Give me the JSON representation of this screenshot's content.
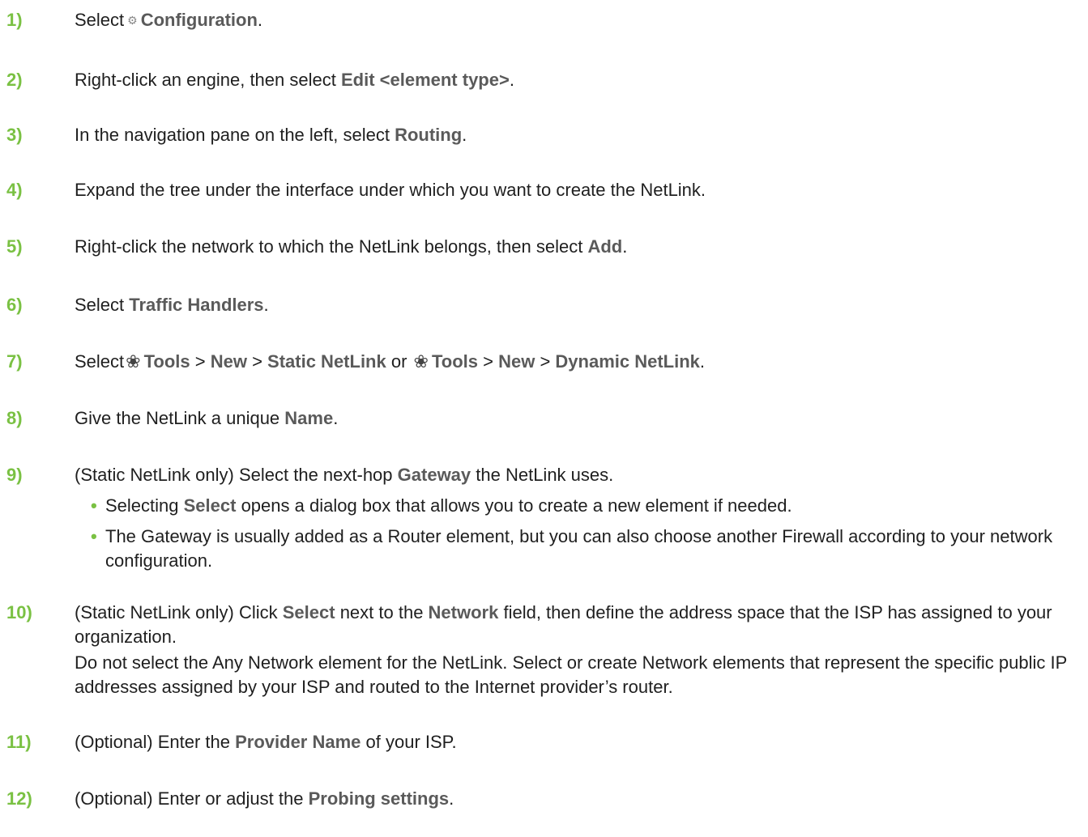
{
  "steps": [
    {
      "num": "1)",
      "a": "Select",
      "icon": "gear-icon",
      "b1": "Configuration",
      "c": "."
    },
    {
      "num": "2)",
      "a": "Right-click an engine, then select ",
      "b1": "Edit <element type>",
      "c": "."
    },
    {
      "num": "3)",
      "a": "In the navigation pane on the left, select ",
      "b1": "Routing",
      "c": "."
    },
    {
      "num": "4)",
      "a": "Expand the tree under the interface under which you want to create the NetLink."
    },
    {
      "num": "5)",
      "a": "Right-click the network to which the NetLink belongs, then select ",
      "b1": "Add",
      "c": "."
    },
    {
      "num": "6)",
      "a": "Select ",
      "b1": "Traffic Handlers",
      "c": "."
    },
    {
      "num": "7)",
      "a": "Select",
      "icon": "tools-gear-icon",
      "b1": "Tools",
      "s1": " > ",
      "b2": "New",
      "s2": " > ",
      "b3": "Static NetLink",
      "s3": " or ",
      "b4": "Tools",
      "s4": " > ",
      "b5": "New",
      "s5": " > ",
      "b6": "Dynamic NetLink",
      "c": "."
    },
    {
      "num": "8)",
      "a": "Give the NetLink a unique ",
      "b1": "Name",
      "c": "."
    },
    {
      "num": "9)",
      "a": "(Static NetLink only) Select the next-hop ",
      "b1": "Gateway",
      "c": " the NetLink uses."
    },
    {
      "num": "10)",
      "a": "(Static NetLink only) Click ",
      "b1": "Select",
      "m1": " next to the ",
      "b2": "Network",
      "c": " field, then define the address space that the ISP has assigned to your organization."
    },
    {
      "num": "11)",
      "a": "(Optional) Enter the ",
      "b1": "Provider Name",
      "c": " of your ISP."
    },
    {
      "num": "12)",
      "a": "(Optional) Enter or adjust the ",
      "b1": "Probing settings",
      "c": "."
    }
  ],
  "step9_bullets": [
    {
      "a": "Selecting ",
      "b": "Select",
      "c": " opens a dialog box that allows you to create a new element if needed."
    },
    {
      "a": "The Gateway is usually added as a Router element, but you can also choose another Firewall according to your network configuration."
    }
  ],
  "step10_note": "Do not select the Any Network element for the NetLink. Select or create Network elements that represent the specific public IP addresses assigned by your ISP and routed to the Internet provider’s router.",
  "bullet_char": "•",
  "accent_color": "#7ac143"
}
